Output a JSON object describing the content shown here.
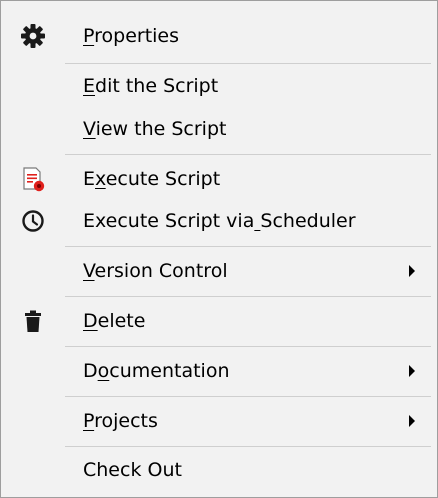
{
  "menu": {
    "items": [
      {
        "label": "Properties",
        "underline_index": 0,
        "icon": "gear-icon",
        "submenu": false
      },
      {
        "label": "Edit the Script",
        "underline_index": 0,
        "icon": "",
        "submenu": false
      },
      {
        "label": "View the Script",
        "underline_index": 0,
        "icon": "",
        "submenu": false
      },
      {
        "label": "Execute Script",
        "underline_index": 1,
        "icon": "execute-script-icon",
        "submenu": false
      },
      {
        "label": "Execute Script via Scheduler",
        "underline_index": 18,
        "icon": "clock-icon",
        "submenu": false
      },
      {
        "label": "Version Control",
        "underline_index": 0,
        "icon": "",
        "submenu": true
      },
      {
        "label": "Delete",
        "underline_index": 0,
        "icon": "trash-icon",
        "submenu": false
      },
      {
        "label": "Documentation",
        "underline_index": 1,
        "icon": "",
        "submenu": true
      },
      {
        "label": "Projects",
        "underline_index": 0,
        "icon": "",
        "submenu": true
      },
      {
        "label": "Check Out",
        "underline_index": -1,
        "icon": "",
        "submenu": false
      }
    ]
  },
  "colors": {
    "menu_background": "#f2f2f2",
    "separator": "#cfcfcf",
    "border": "#9e9e9e",
    "execute_icon_red": "#e0201c"
  }
}
